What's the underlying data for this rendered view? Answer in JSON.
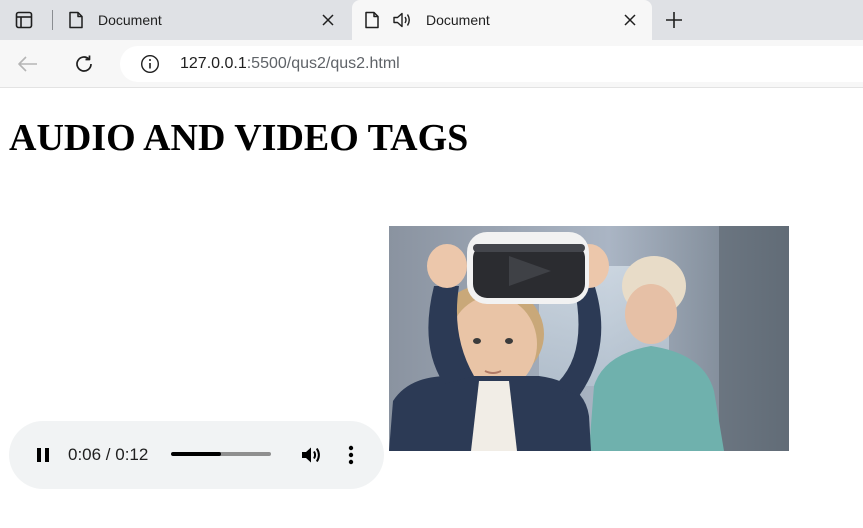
{
  "browser": {
    "tabs": [
      {
        "title": "Document",
        "active": false
      },
      {
        "title": "Document",
        "active": true,
        "playing_audio": true
      }
    ],
    "address": {
      "host": "127.0.0.1",
      "rest": ":5500/qus2/qus2.html"
    }
  },
  "page": {
    "heading": "AUDIO AND VIDEO TAGS",
    "audio": {
      "time": "0:06 / 0:12",
      "progress_fraction": 0.5
    },
    "video": {
      "frame_icon": "vr-headset-child-frame"
    }
  },
  "colors": {
    "tabstrip": "#dfe1e5",
    "toolbar": "#f7f7f7",
    "player_bg": "#f1f3f4"
  }
}
